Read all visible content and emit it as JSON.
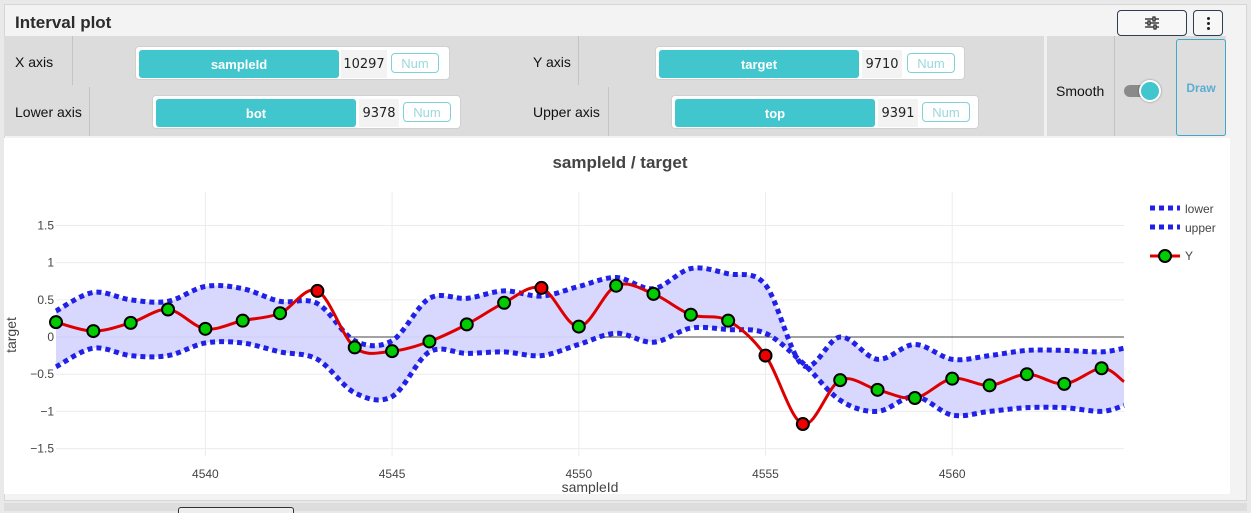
{
  "panel": {
    "title": "Interval plot",
    "settings_icon": "sliders-icon",
    "more_icon": "vertical-dots-icon"
  },
  "controls": {
    "x_axis": {
      "label": "X axis",
      "field": "sampleId",
      "count": "10297",
      "num": "Num"
    },
    "y_axis": {
      "label": "Y axis",
      "field": "target",
      "count": "9710",
      "num": "Num"
    },
    "lower_axis": {
      "label": "Lower axis",
      "field": "bot",
      "count": "9378",
      "num": "Num"
    },
    "upper_axis": {
      "label": "Upper axis",
      "field": "top",
      "count": "9391",
      "num": "Num"
    },
    "smooth": {
      "label": "Smooth",
      "on": true
    },
    "draw_label": "Draw"
  },
  "colors": {
    "accent": "#40c6cc",
    "band_fill": "#d6d6ff",
    "interval_line": "#2020e6",
    "y_line": "#dd0000",
    "marker_in": "#00cc00",
    "marker_out": "#ee0000"
  },
  "chart_data": {
    "type": "line",
    "title": "sampleId / target",
    "xlabel": "sampleId",
    "ylabel": "target",
    "xlim": [
      4536,
      4564.6
    ],
    "ylim": [
      -1.6,
      1.95
    ],
    "xticks": [
      4540,
      4545,
      4550,
      4555,
      4560
    ],
    "yticks": [
      -1.5,
      -1,
      -0.5,
      0,
      0.5,
      1,
      1.5
    ],
    "ytick_labels": [
      "−1.5",
      "−1",
      "−0.5",
      "0",
      "0.5",
      "1",
      "1.5"
    ],
    "grid": true,
    "legend_position": "top-right",
    "legend": [
      "lower",
      "upper",
      "Y"
    ],
    "x": [
      4536,
      4537,
      4538,
      4539,
      4540,
      4541,
      4542,
      4543,
      4544,
      4545,
      4546,
      4547,
      4548,
      4549,
      4550,
      4551,
      4552,
      4553,
      4554,
      4555,
      4556,
      4557,
      4558,
      4559,
      4560,
      4561,
      4562,
      4563,
      4564,
      4564.6
    ],
    "series": [
      {
        "name": "lower",
        "values": [
          -0.4,
          -0.15,
          -0.25,
          -0.25,
          -0.08,
          -0.08,
          -0.2,
          -0.3,
          -0.75,
          -0.8,
          -0.2,
          -0.22,
          -0.2,
          -0.25,
          -0.1,
          0.05,
          -0.07,
          0.12,
          0.1,
          0.05,
          -0.35,
          -0.85,
          -1.0,
          -0.8,
          -1.05,
          -1.0,
          -0.95,
          -0.95,
          -1.0,
          -0.92
        ]
      },
      {
        "name": "upper",
        "values": [
          0.35,
          0.6,
          0.5,
          0.48,
          0.68,
          0.65,
          0.48,
          0.45,
          -0.05,
          -0.05,
          0.52,
          0.52,
          0.62,
          0.55,
          0.68,
          0.8,
          0.65,
          0.92,
          0.85,
          0.7,
          -0.38,
          0.0,
          -0.3,
          -0.1,
          -0.3,
          -0.25,
          -0.18,
          -0.18,
          -0.2,
          -0.15
        ]
      },
      {
        "name": "Y",
        "values": [
          0.2,
          0.08,
          0.19,
          0.37,
          0.11,
          0.22,
          0.32,
          0.62,
          -0.14,
          -0.19,
          -0.06,
          0.17,
          0.46,
          0.66,
          0.14,
          0.69,
          0.58,
          0.3,
          0.22,
          -0.25,
          -1.17,
          -0.58,
          -0.71,
          -0.82,
          -0.56,
          -0.65,
          -0.5,
          -0.63,
          -0.42,
          -0.6
        ],
        "markers": [
          true,
          true,
          true,
          true,
          true,
          true,
          true,
          true,
          true,
          true,
          true,
          true,
          true,
          true,
          true,
          true,
          true,
          true,
          true,
          true,
          true,
          true,
          true,
          true,
          true,
          true,
          true,
          true,
          true,
          false
        ],
        "outside": [
          false,
          false,
          false,
          false,
          false,
          false,
          false,
          true,
          false,
          false,
          false,
          false,
          false,
          true,
          false,
          false,
          false,
          false,
          false,
          true,
          true,
          false,
          false,
          false,
          false,
          false,
          false,
          false,
          false,
          false
        ]
      }
    ]
  }
}
